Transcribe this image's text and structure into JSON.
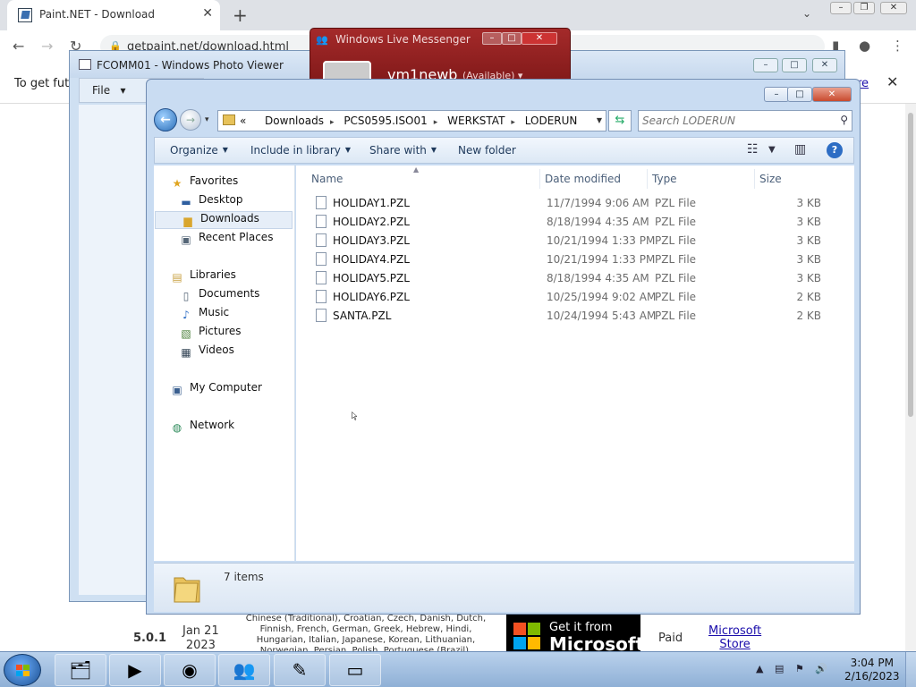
{
  "browser": {
    "tab_title": "Paint.NET - Download",
    "tab_close": "✕",
    "new_tab": "+",
    "url": "getpaint.net/download.html",
    "infobar_text": "To get futu",
    "infobar_link": "re",
    "infobar_close": "✕"
  },
  "page": {
    "version": "5.0.1",
    "date_line1": "Jan 21",
    "date_line2": "2023",
    "languages": "Chinese (Traditional), Croatian, Czech, Danish, Dutch, Finnish, French, German, Greek, Hebrew, Hindi, Hungarian, Italian, Japanese, Korean, Lithuanian, Norwegian, Persian, Polish, Portuguese (Brazil),",
    "store_badge_top": "Get it from",
    "store_badge_bottom": "Microsoft",
    "price": "Paid",
    "store_link_line1": "Microsoft",
    "store_link_line2": "Store"
  },
  "messenger": {
    "title": "Windows Live Messenger",
    "user": "vm1newb",
    "status": "(Available) ▾"
  },
  "photo_viewer": {
    "title": "FCOMM01 - Windows Photo Viewer",
    "file_menu": "File"
  },
  "explorer": {
    "breadcrumb_prefix": "«",
    "breadcrumbs": [
      "Downloads",
      "PCS0595.ISO01",
      "WERKSTAT",
      "LODERUN"
    ],
    "search_placeholder": "Search LODERUN",
    "toolbar": {
      "organize": "Organize",
      "include": "Include in library",
      "share": "Share with",
      "new_folder": "New folder"
    },
    "nav": {
      "favorites": "Favorites",
      "desktop": "Desktop",
      "downloads": "Downloads",
      "recent": "Recent Places",
      "libraries": "Libraries",
      "documents": "Documents",
      "music": "Music",
      "pictures": "Pictures",
      "videos": "Videos",
      "computer": "My Computer",
      "network": "Network"
    },
    "columns": {
      "name": "Name",
      "date": "Date modified",
      "type": "Type",
      "size": "Size"
    },
    "files": [
      {
        "name": "HOLIDAY1.PZL",
        "date": "11/7/1994 9:06 AM",
        "type": "PZL File",
        "size": "3 KB"
      },
      {
        "name": "HOLIDAY2.PZL",
        "date": "8/18/1994 4:35 AM",
        "type": "PZL File",
        "size": "3 KB"
      },
      {
        "name": "HOLIDAY3.PZL",
        "date": "10/21/1994 1:33 PM",
        "type": "PZL File",
        "size": "3 KB"
      },
      {
        "name": "HOLIDAY4.PZL",
        "date": "10/21/1994 1:33 PM",
        "type": "PZL File",
        "size": "3 KB"
      },
      {
        "name": "HOLIDAY5.PZL",
        "date": "8/18/1994 4:35 AM",
        "type": "PZL File",
        "size": "3 KB"
      },
      {
        "name": "HOLIDAY6.PZL",
        "date": "10/25/1994 9:02 AM",
        "type": "PZL File",
        "size": "2 KB"
      },
      {
        "name": "SANTA.PZL",
        "date": "10/24/1994 5:43 AM",
        "type": "PZL File",
        "size": "2 KB"
      }
    ],
    "item_count": "7 items"
  },
  "taskbar": {
    "time": "3:04 PM",
    "date": "2/16/2023"
  },
  "colors": {
    "explorer_frame": "#c9dcf2",
    "messenger_red": "#a42a2a",
    "taskbar": "#b9d1ec"
  }
}
